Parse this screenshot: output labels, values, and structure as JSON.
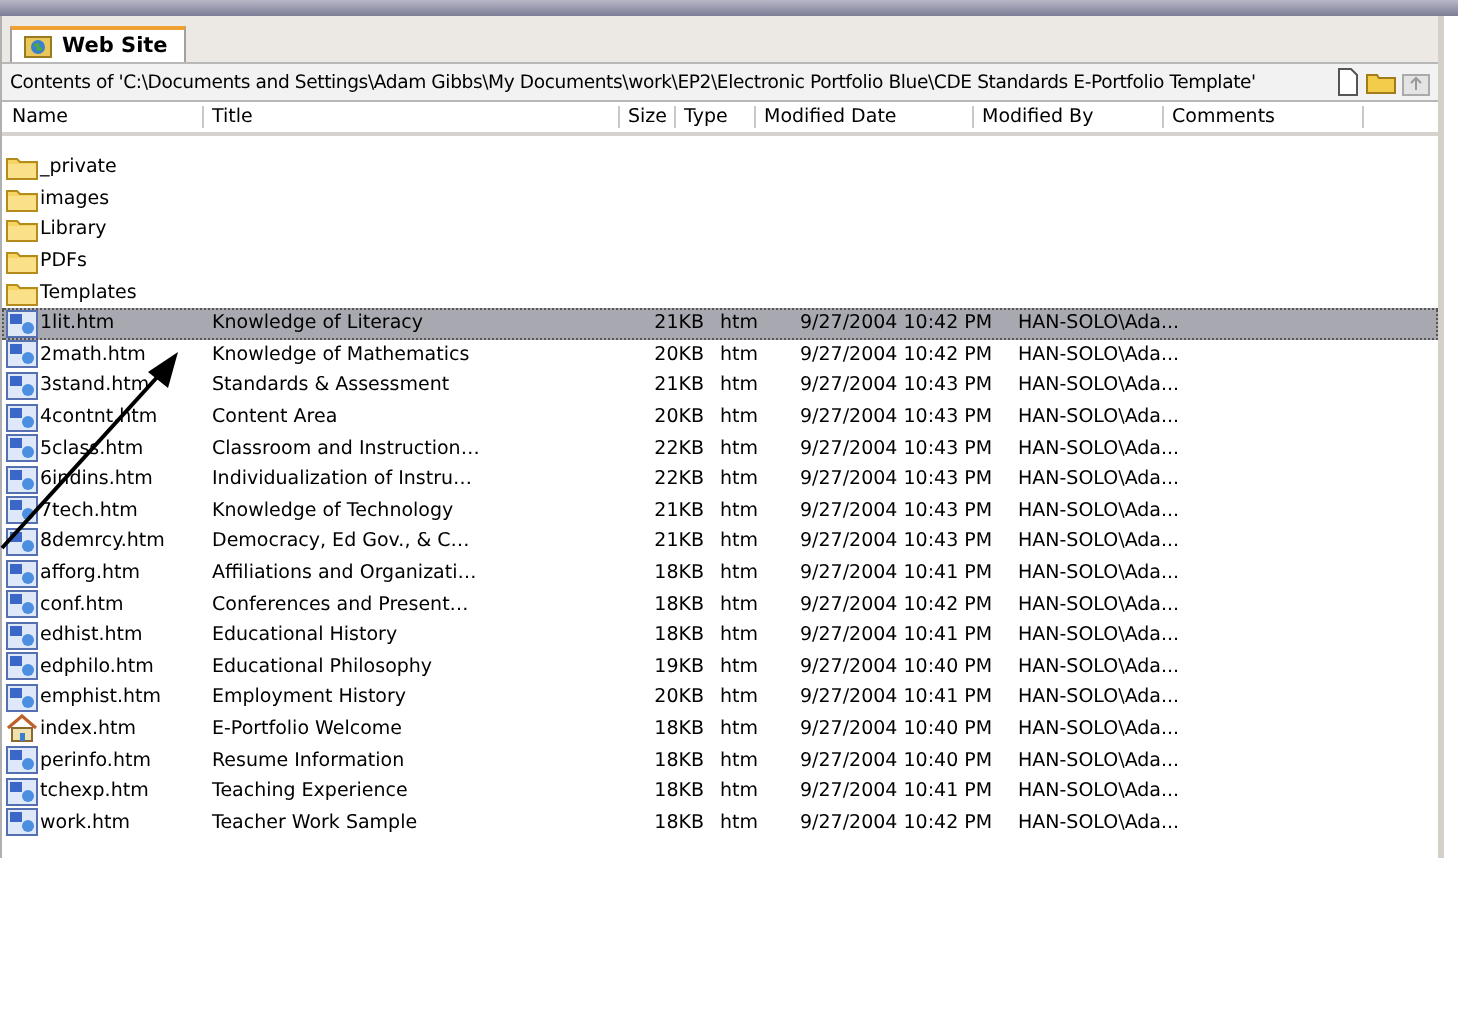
{
  "tab": {
    "label": "Web Site",
    "selected": true
  },
  "path_bar": {
    "text": "Contents of 'C:\\Documents and Settings\\Adam Gibbs\\My Documents\\work\\EP2\\Electronic Portfolio Blue\\CDE Standards E-Portfolio Template'"
  },
  "table": {
    "columns": [
      "Name",
      "Title",
      "Size",
      "Type",
      "Modified Date",
      "Modified By",
      "Comments"
    ],
    "rows": [
      {
        "kind": "folder",
        "name": "_private",
        "selected": false
      },
      {
        "kind": "folder",
        "name": "images",
        "selected": false
      },
      {
        "kind": "folder",
        "name": "Library",
        "selected": false
      },
      {
        "kind": "folder",
        "name": "PDFs",
        "selected": false
      },
      {
        "kind": "folder",
        "name": "Templates",
        "selected": false
      },
      {
        "kind": "page",
        "name": "1lit.htm",
        "title": "Knowledge of Literacy",
        "size": "21KB",
        "type": "htm",
        "modified": "9/27/2004 10:42 PM",
        "by": "HAN-SOLO\\Ada...",
        "selected": true
      },
      {
        "kind": "page",
        "name": "2math.htm",
        "title": "Knowledge of Mathematics",
        "size": "20KB",
        "type": "htm",
        "modified": "9/27/2004 10:42 PM",
        "by": "HAN-SOLO\\Ada...",
        "selected": false
      },
      {
        "kind": "page",
        "name": "3stand.htm",
        "title": "Standards & Assessment",
        "size": "21KB",
        "type": "htm",
        "modified": "9/27/2004 10:43 PM",
        "by": "HAN-SOLO\\Ada...",
        "selected": false
      },
      {
        "kind": "page",
        "name": "4contnt.htm",
        "title": "Content Area",
        "size": "20KB",
        "type": "htm",
        "modified": "9/27/2004 10:43 PM",
        "by": "HAN-SOLO\\Ada...",
        "selected": false
      },
      {
        "kind": "page",
        "name": "5class.htm",
        "title": "Classroom and Instruction…",
        "size": "22KB",
        "type": "htm",
        "modified": "9/27/2004 10:43 PM",
        "by": "HAN-SOLO\\Ada...",
        "selected": false
      },
      {
        "kind": "page",
        "name": "6indins.htm",
        "title": "Individualization of Instru…",
        "size": "22KB",
        "type": "htm",
        "modified": "9/27/2004 10:43 PM",
        "by": "HAN-SOLO\\Ada...",
        "selected": false
      },
      {
        "kind": "page",
        "name": "7tech.htm",
        "title": "Knowledge of Technology",
        "size": "21KB",
        "type": "htm",
        "modified": "9/27/2004 10:43 PM",
        "by": "HAN-SOLO\\Ada...",
        "selected": false
      },
      {
        "kind": "page",
        "name": "8demrcy.htm",
        "title": "Democracy, Ed Gov., & C…",
        "size": "21KB",
        "type": "htm",
        "modified": "9/27/2004 10:43 PM",
        "by": "HAN-SOLO\\Ada...",
        "selected": false
      },
      {
        "kind": "page",
        "name": "afforg.htm",
        "title": "Affiliations and Organizati…",
        "size": "18KB",
        "type": "htm",
        "modified": "9/27/2004 10:41 PM",
        "by": "HAN-SOLO\\Ada...",
        "selected": false
      },
      {
        "kind": "page",
        "name": "conf.htm",
        "title": "Conferences and Present…",
        "size": "18KB",
        "type": "htm",
        "modified": "9/27/2004 10:42 PM",
        "by": "HAN-SOLO\\Ada...",
        "selected": false
      },
      {
        "kind": "page",
        "name": "edhist.htm",
        "title": "Educational History",
        "size": "18KB",
        "type": "htm",
        "modified": "9/27/2004 10:41 PM",
        "by": "HAN-SOLO\\Ada...",
        "selected": false
      },
      {
        "kind": "page",
        "name": "edphilo.htm",
        "title": "Educational Philosophy",
        "size": "19KB",
        "type": "htm",
        "modified": "9/27/2004 10:40 PM",
        "by": "HAN-SOLO\\Ada...",
        "selected": false
      },
      {
        "kind": "page",
        "name": "emphist.htm",
        "title": "Employment History",
        "size": "20KB",
        "type": "htm",
        "modified": "9/27/2004 10:41 PM",
        "by": "HAN-SOLO\\Ada...",
        "selected": false
      },
      {
        "kind": "home",
        "name": "index.htm",
        "title": "E-Portfolio Welcome",
        "size": "18KB",
        "type": "htm",
        "modified": "9/27/2004 10:40 PM",
        "by": "HAN-SOLO\\Ada...",
        "selected": false
      },
      {
        "kind": "page",
        "name": "perinfo.htm",
        "title": "Resume Information",
        "size": "18KB",
        "type": "htm",
        "modified": "9/27/2004 10:40 PM",
        "by": "HAN-SOLO\\Ada...",
        "selected": false
      },
      {
        "kind": "page",
        "name": "tchexp.htm",
        "title": "Teaching Experience",
        "size": "18KB",
        "type": "htm",
        "modified": "9/27/2004 10:41 PM",
        "by": "HAN-SOLO\\Ada...",
        "selected": false
      },
      {
        "kind": "page",
        "name": "work.htm",
        "title": "Teacher Work Sample",
        "size": "18KB",
        "type": "htm",
        "modified": "9/27/2004 10:42 PM",
        "by": "HAN-SOLO\\Ada...",
        "selected": false
      }
    ]
  }
}
